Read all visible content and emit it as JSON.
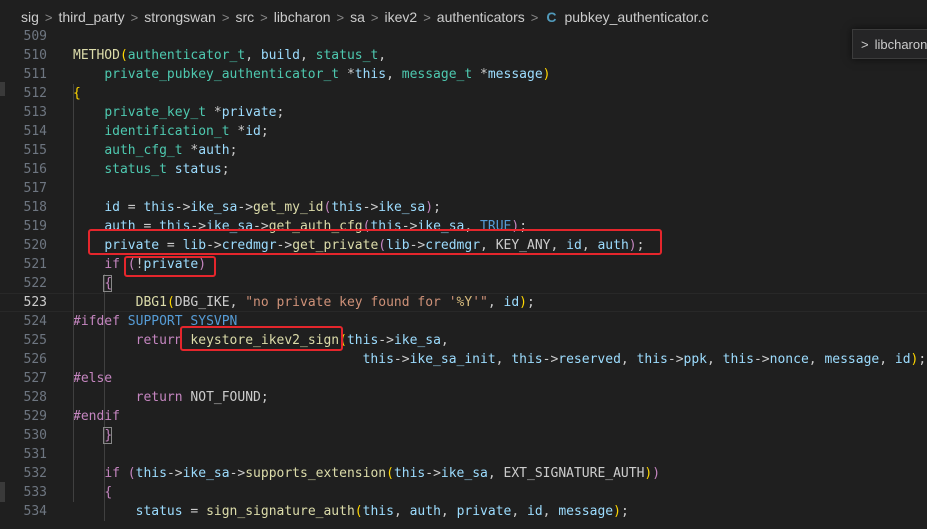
{
  "breadcrumb": {
    "items": [
      "sig",
      "third_party",
      "strongswan",
      "src",
      "libcharon",
      "sa",
      "ikev2",
      "authenticators"
    ],
    "separator": ">",
    "file_icon": "C",
    "file_name": "pubkey_authenticator.c"
  },
  "outline": {
    "chevron": ">",
    "label": "libcharon"
  },
  "colors": {
    "background": "#1f1f1f",
    "highlight_box": "#e5262c",
    "line_number": "#6e7681",
    "function": "#dcdcaa",
    "type": "#4ec9b0",
    "keyword": "#569cd6",
    "control": "#c586c0",
    "variable": "#9cdcfe",
    "string": "#ce9178",
    "constant": "#4fc1ff"
  },
  "active_line": "523",
  "lines": [
    {
      "n": "509",
      "t": []
    },
    {
      "n": "510",
      "t": [
        [
          "tk-func",
          "METHOD"
        ],
        [
          "tk-br",
          "("
        ],
        [
          "tk-type",
          "authenticator_t"
        ],
        [
          "tk-plain",
          ", "
        ],
        [
          "tk-var",
          "build"
        ],
        [
          "tk-plain",
          ", "
        ],
        [
          "tk-type",
          "status_t"
        ],
        [
          "tk-plain",
          ","
        ]
      ]
    },
    {
      "n": "511",
      "t": [
        [
          "tk-plain",
          "    "
        ],
        [
          "tk-type",
          "private_pubkey_authenticator_t"
        ],
        [
          "tk-plain",
          " *"
        ],
        [
          "tk-var",
          "this"
        ],
        [
          "tk-plain",
          ", "
        ],
        [
          "tk-type",
          "message_t"
        ],
        [
          "tk-plain",
          " *"
        ],
        [
          "tk-var",
          "message"
        ],
        [
          "tk-br",
          ")"
        ]
      ]
    },
    {
      "n": "512",
      "t": [
        [
          "tk-br",
          "{"
        ]
      ]
    },
    {
      "n": "513",
      "t": [
        [
          "tk-plain",
          "    "
        ],
        [
          "tk-type",
          "private_key_t"
        ],
        [
          "tk-plain",
          " *"
        ],
        [
          "tk-var",
          "private"
        ],
        [
          "tk-plain",
          ";"
        ]
      ]
    },
    {
      "n": "514",
      "t": [
        [
          "tk-plain",
          "    "
        ],
        [
          "tk-type",
          "identification_t"
        ],
        [
          "tk-plain",
          " *"
        ],
        [
          "tk-var",
          "id"
        ],
        [
          "tk-plain",
          ";"
        ]
      ]
    },
    {
      "n": "515",
      "t": [
        [
          "tk-plain",
          "    "
        ],
        [
          "tk-type",
          "auth_cfg_t"
        ],
        [
          "tk-plain",
          " *"
        ],
        [
          "tk-var",
          "auth"
        ],
        [
          "tk-plain",
          ";"
        ]
      ]
    },
    {
      "n": "516",
      "t": [
        [
          "tk-plain",
          "    "
        ],
        [
          "tk-type",
          "status_t"
        ],
        [
          "tk-plain",
          " "
        ],
        [
          "tk-var",
          "status"
        ],
        [
          "tk-plain",
          ";"
        ]
      ]
    },
    {
      "n": "517",
      "t": []
    },
    {
      "n": "518",
      "t": [
        [
          "tk-plain",
          "    "
        ],
        [
          "tk-var",
          "id"
        ],
        [
          "tk-plain",
          " = "
        ],
        [
          "tk-var",
          "this"
        ],
        [
          "tk-plain",
          "->"
        ],
        [
          "tk-var",
          "ike_sa"
        ],
        [
          "tk-plain",
          "->"
        ],
        [
          "tk-func",
          "get_my_id"
        ],
        [
          "tk-ctrl",
          "("
        ],
        [
          "tk-var",
          "this"
        ],
        [
          "tk-plain",
          "->"
        ],
        [
          "tk-var",
          "ike_sa"
        ],
        [
          "tk-ctrl",
          ")"
        ],
        [
          "tk-plain",
          ";"
        ]
      ]
    },
    {
      "n": "519",
      "t": [
        [
          "tk-plain",
          "    "
        ],
        [
          "tk-var",
          "auth"
        ],
        [
          "tk-plain",
          " = "
        ],
        [
          "tk-var",
          "this"
        ],
        [
          "tk-plain",
          "->"
        ],
        [
          "tk-var",
          "ike_sa"
        ],
        [
          "tk-plain",
          "->"
        ],
        [
          "tk-func",
          "get_auth_cfg"
        ],
        [
          "tk-ctrl",
          "("
        ],
        [
          "tk-var",
          "this"
        ],
        [
          "tk-plain",
          "->"
        ],
        [
          "tk-var",
          "ike_sa"
        ],
        [
          "tk-plain",
          ", "
        ],
        [
          "tk-kw",
          "TRUE"
        ],
        [
          "tk-ctrl",
          ")"
        ],
        [
          "tk-plain",
          ";"
        ]
      ]
    },
    {
      "n": "520",
      "t": [
        [
          "tk-plain",
          "    "
        ],
        [
          "tk-var",
          "private"
        ],
        [
          "tk-plain",
          " = "
        ],
        [
          "tk-var",
          "lib"
        ],
        [
          "tk-plain",
          "->"
        ],
        [
          "tk-var",
          "credmgr"
        ],
        [
          "tk-plain",
          "->"
        ],
        [
          "tk-func",
          "get_private"
        ],
        [
          "tk-ctrl",
          "("
        ],
        [
          "tk-var",
          "lib"
        ],
        [
          "tk-plain",
          "->"
        ],
        [
          "tk-var",
          "credmgr"
        ],
        [
          "tk-plain",
          ", "
        ],
        [
          "tk-plain",
          "KEY_ANY"
        ],
        [
          "tk-plain",
          ", "
        ],
        [
          "tk-var",
          "id"
        ],
        [
          "tk-plain",
          ", "
        ],
        [
          "tk-var",
          "auth"
        ],
        [
          "tk-ctrl",
          ")"
        ],
        [
          "tk-plain",
          ";"
        ]
      ]
    },
    {
      "n": "521",
      "t": [
        [
          "tk-plain",
          "    "
        ],
        [
          "tk-ctrl",
          "if"
        ],
        [
          "tk-plain",
          " "
        ],
        [
          "tk-ctrl",
          "("
        ],
        [
          "tk-plain",
          "!"
        ],
        [
          "tk-var",
          "private"
        ],
        [
          "tk-ctrl",
          ")"
        ]
      ]
    },
    {
      "n": "522",
      "t": [
        [
          "tk-plain",
          "    "
        ],
        [
          "tk-ctrl",
          "{"
        ]
      ]
    },
    {
      "n": "523",
      "t": [
        [
          "tk-plain",
          "        "
        ],
        [
          "tk-func",
          "DBG1"
        ],
        [
          "tk-br",
          "("
        ],
        [
          "tk-plain",
          "DBG_IKE"
        ],
        [
          "tk-plain",
          ", "
        ],
        [
          "tk-str",
          "\"no private key found for '"
        ],
        [
          "tk-esc",
          "%Y"
        ],
        [
          "tk-str",
          "'\""
        ],
        [
          "tk-plain",
          ", "
        ],
        [
          "tk-var",
          "id"
        ],
        [
          "tk-br",
          ")"
        ],
        [
          "tk-plain",
          ";"
        ]
      ]
    },
    {
      "n": "524",
      "t": [
        [
          "tk-ctrl",
          "#ifdef"
        ],
        [
          "tk-plain",
          " "
        ],
        [
          "tk-kw",
          "SUPPORT_SYSVPN"
        ]
      ]
    },
    {
      "n": "525",
      "t": [
        [
          "tk-plain",
          "        "
        ],
        [
          "tk-ctrl",
          "return"
        ],
        [
          "tk-plain",
          " "
        ],
        [
          "tk-func",
          "keystore_ikev2_sign"
        ],
        [
          "tk-br",
          "("
        ],
        [
          "tk-var",
          "this"
        ],
        [
          "tk-plain",
          "->"
        ],
        [
          "tk-var",
          "ike_sa"
        ],
        [
          "tk-plain",
          ","
        ]
      ]
    },
    {
      "n": "526",
      "t": [
        [
          "tk-plain",
          "                                     "
        ],
        [
          "tk-var",
          "this"
        ],
        [
          "tk-plain",
          "->"
        ],
        [
          "tk-var",
          "ike_sa_init"
        ],
        [
          "tk-plain",
          ", "
        ],
        [
          "tk-var",
          "this"
        ],
        [
          "tk-plain",
          "->"
        ],
        [
          "tk-var",
          "reserved"
        ],
        [
          "tk-plain",
          ", "
        ],
        [
          "tk-var",
          "this"
        ],
        [
          "tk-plain",
          "->"
        ],
        [
          "tk-var",
          "ppk"
        ],
        [
          "tk-plain",
          ", "
        ],
        [
          "tk-var",
          "this"
        ],
        [
          "tk-plain",
          "->"
        ],
        [
          "tk-var",
          "nonce"
        ],
        [
          "tk-plain",
          ", "
        ],
        [
          "tk-var",
          "message"
        ],
        [
          "tk-plain",
          ", "
        ],
        [
          "tk-var",
          "id"
        ],
        [
          "tk-br",
          ")"
        ],
        [
          "tk-plain",
          ";"
        ]
      ]
    },
    {
      "n": "527",
      "t": [
        [
          "tk-ctrl",
          "#else"
        ]
      ]
    },
    {
      "n": "528",
      "t": [
        [
          "tk-plain",
          "        "
        ],
        [
          "tk-ctrl",
          "return"
        ],
        [
          "tk-plain",
          " NOT_FOUND;"
        ]
      ]
    },
    {
      "n": "529",
      "t": [
        [
          "tk-ctrl",
          "#endif"
        ]
      ]
    },
    {
      "n": "530",
      "t": [
        [
          "tk-plain",
          "    "
        ],
        [
          "tk-ctrl",
          "}"
        ]
      ]
    },
    {
      "n": "531",
      "t": []
    },
    {
      "n": "532",
      "t": [
        [
          "tk-plain",
          "    "
        ],
        [
          "tk-ctrl",
          "if"
        ],
        [
          "tk-plain",
          " "
        ],
        [
          "tk-ctrl",
          "("
        ],
        [
          "tk-var",
          "this"
        ],
        [
          "tk-plain",
          "->"
        ],
        [
          "tk-var",
          "ike_sa"
        ],
        [
          "tk-plain",
          "->"
        ],
        [
          "tk-func",
          "supports_extension"
        ],
        [
          "tk-br",
          "("
        ],
        [
          "tk-var",
          "this"
        ],
        [
          "tk-plain",
          "->"
        ],
        [
          "tk-var",
          "ike_sa"
        ],
        [
          "tk-plain",
          ", EXT_SIGNATURE_AUTH"
        ],
        [
          "tk-br",
          ")"
        ],
        [
          "tk-ctrl",
          ")"
        ]
      ]
    },
    {
      "n": "533",
      "t": [
        [
          "tk-plain",
          "    "
        ],
        [
          "tk-ctrl",
          "{"
        ]
      ]
    },
    {
      "n": "534",
      "t": [
        [
          "tk-plain",
          "        "
        ],
        [
          "tk-var",
          "status"
        ],
        [
          "tk-plain",
          " = "
        ],
        [
          "tk-func",
          "sign_signature_auth"
        ],
        [
          "tk-br",
          "("
        ],
        [
          "tk-var",
          "this"
        ],
        [
          "tk-plain",
          ", "
        ],
        [
          "tk-var",
          "auth"
        ],
        [
          "tk-plain",
          ", "
        ],
        [
          "tk-var",
          "private"
        ],
        [
          "tk-plain",
          ", "
        ],
        [
          "tk-var",
          "id"
        ],
        [
          "tk-plain",
          ", "
        ],
        [
          "tk-var",
          "message"
        ],
        [
          "tk-br",
          ")"
        ],
        [
          "tk-plain",
          ";"
        ]
      ]
    }
  ]
}
